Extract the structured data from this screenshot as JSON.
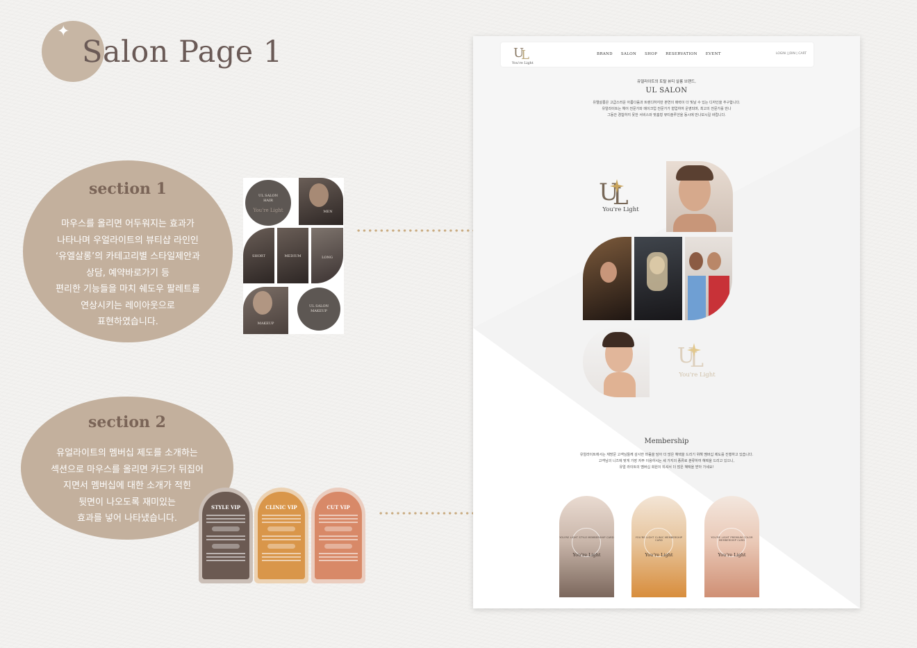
{
  "title": {
    "text": "Salon Page 1",
    "star": "✦"
  },
  "section1": {
    "heading": "section 1",
    "description": [
      "마우스를 올리면 어두워지는 효과가",
      "나타나며 우얼라이트의 뷰티샵 라인인",
      "‘유엘살롱’의 카테고리별 스타일제안과",
      "상담, 예약바로가기 등",
      "편리한 기능들을 마치 쉐도우 팔레트를",
      "연상시키는 레이아웃으로",
      "표현하였습니다."
    ],
    "thumb": {
      "card_a_title": "UL SALON",
      "card_a_sub": "HAIR",
      "card_a_logo": "You're Light",
      "men": "MEN",
      "short": "SHORT",
      "medium": "MEDIUM",
      "long": "LONG",
      "makeup": "MAKEUP",
      "card_b_title": "UL SALON",
      "card_b_sub": "MAKEUP"
    }
  },
  "section2": {
    "heading": "section 2",
    "description": [
      "유얼라이트의 멤버십 제도를 소개하는",
      "섹션으로 마우스를 올리면 카드가 뒤집어",
      "지면서 멤버십에 대한 소개가 적힌",
      "뒷면이 나오도록 재미있는",
      "효과를 넣어 나타냈습니다."
    ],
    "cards": [
      {
        "title": "STYLE VIP",
        "color": "#6b5a52",
        "frame": "#cbbfb7"
      },
      {
        "title": "CLINIC VIP",
        "color": "#d9964a",
        "frame": "#ecd2b3"
      },
      {
        "title": "CUT VIP",
        "color": "#d88968",
        "frame": "#ebcdbf"
      }
    ]
  },
  "site": {
    "nav": {
      "logo": "You're Light",
      "menu": [
        "BRAND",
        "SALON",
        "SHOP",
        "RESERVATION",
        "EVENT"
      ],
      "util": "LOGIN | JOIN | CART"
    },
    "intro": {
      "small": "유얼라이트의 토탈 뷰티 살롱 브랜드,",
      "title": "UL SALON",
      "body": [
        "유엘살롱은 고급스러운 아름다움과 트렌디하지만 본연의 매력이 더 빛날 수 있는 디자인을 추구합니다.",
        "유얼라이트는 헤어 전문가와 메이크업 전문가가 협업하여 운영되며, 최고의 전문가를 만나",
        "그동안 경험하지 못한 서비스와 맞춤형 뷰티솔루션을 동시에 만나보시길 바랍니다."
      ]
    },
    "gallery_logo_a": "You're Light",
    "gallery_logo_b": "You're Light",
    "membership": {
      "title": "Membership",
      "body": [
        "유얼라이트에서는 재방문 고객님들께 감사한 마음을 담아 더 많은 혜택을 드리기 위해 멤버십 제도를 진행하고 있습니다.",
        "고객님의 니즈에 맞게 가장 자주 이용하시는 세 가지의 종류로 분류하여 혜택을 드리고 있으니,",
        "유얼 라이트의 멤버십 회원이 되셔서 더 많은 혜택을 받아 가세요!"
      ],
      "cards": [
        {
          "ring": "YOU'RE LIGHT STYLE MEMBERSHIP CARD",
          "logo": "You're Light"
        },
        {
          "ring": "YOU'RE LIGHT CLINIC MEMBERSHIP CARD",
          "logo": "You're Light"
        },
        {
          "ring": "YOU'RE LIGHT PREMIUM COLOR MEMBERSHIP CARD",
          "logo": "You're Light"
        }
      ]
    }
  }
}
